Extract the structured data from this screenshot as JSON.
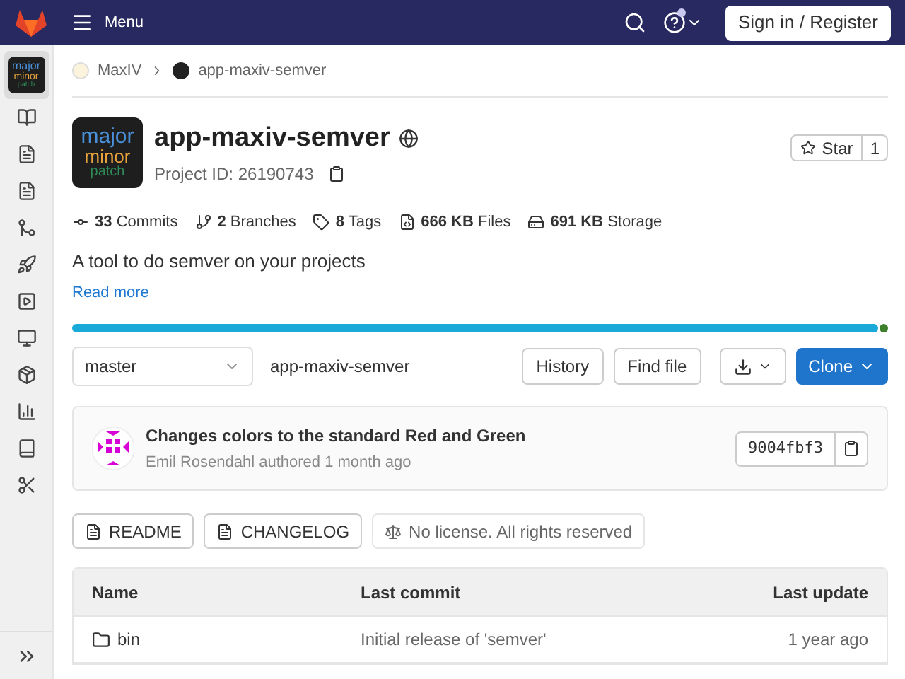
{
  "topbar": {
    "menu": "Menu",
    "sign_in": "Sign in / Register",
    "help_badge": true
  },
  "sidebar": {
    "logo": [
      "major",
      "minor",
      "patch"
    ],
    "items": [
      {
        "selected": true
      },
      {
        "selected": false
      },
      {
        "selected": false
      },
      {
        "selected": false
      },
      {
        "selected": false
      },
      {
        "selected": false
      },
      {
        "selected": false
      },
      {
        "selected": false
      },
      {
        "selected": false
      },
      {
        "selected": false
      },
      {
        "selected": false
      },
      {
        "selected": false
      }
    ]
  },
  "breadcrumb": [
    "MaxIV",
    "app-maxiv-semver"
  ],
  "project": {
    "logo": [
      "major",
      "minor",
      "patch"
    ],
    "name": "app-maxiv-semver",
    "id": "Project ID: 26190743",
    "star": "Star",
    "star_count": "1"
  },
  "stats": [
    {
      "kind": "commits",
      "value": "33",
      "label": "Commits"
    },
    {
      "kind": "branches",
      "value": "2",
      "label": "Branches"
    },
    {
      "kind": "tags",
      "value": "8",
      "label": "Tags"
    },
    {
      "kind": "files",
      "value": "666 KB",
      "label": "Files"
    },
    {
      "kind": "storage",
      "value": "691 KB",
      "label": "Storage"
    }
  ],
  "description": "A tool to do semver on your projects",
  "read_more": "Read more",
  "languages": [
    {
      "color": "#1aaad9"
    },
    {
      "color": "#3d7f2b"
    }
  ],
  "toolbar": {
    "branch": "master",
    "path": "app-maxiv-semver",
    "history": "History",
    "find_file": "Find file",
    "clone": "Clone"
  },
  "last_commit": {
    "title": "Changes colors to the standard Red and Green",
    "author": "Emil Rosendahl",
    "meta": "authored 1 month ago",
    "sha": "9004fbf3"
  },
  "doc_buttons": [
    {
      "kind": "file",
      "label": "README"
    },
    {
      "kind": "file",
      "label": "CHANGELOG"
    },
    {
      "kind": "license",
      "label": "No license. All rights reserved"
    }
  ],
  "table": {
    "columns": [
      "Name",
      "Last commit",
      "Last update"
    ],
    "rows": [
      {
        "kind": "folder",
        "name": "bin",
        "commit": "Initial release of 'semver'",
        "updated": "1 year ago"
      }
    ]
  }
}
